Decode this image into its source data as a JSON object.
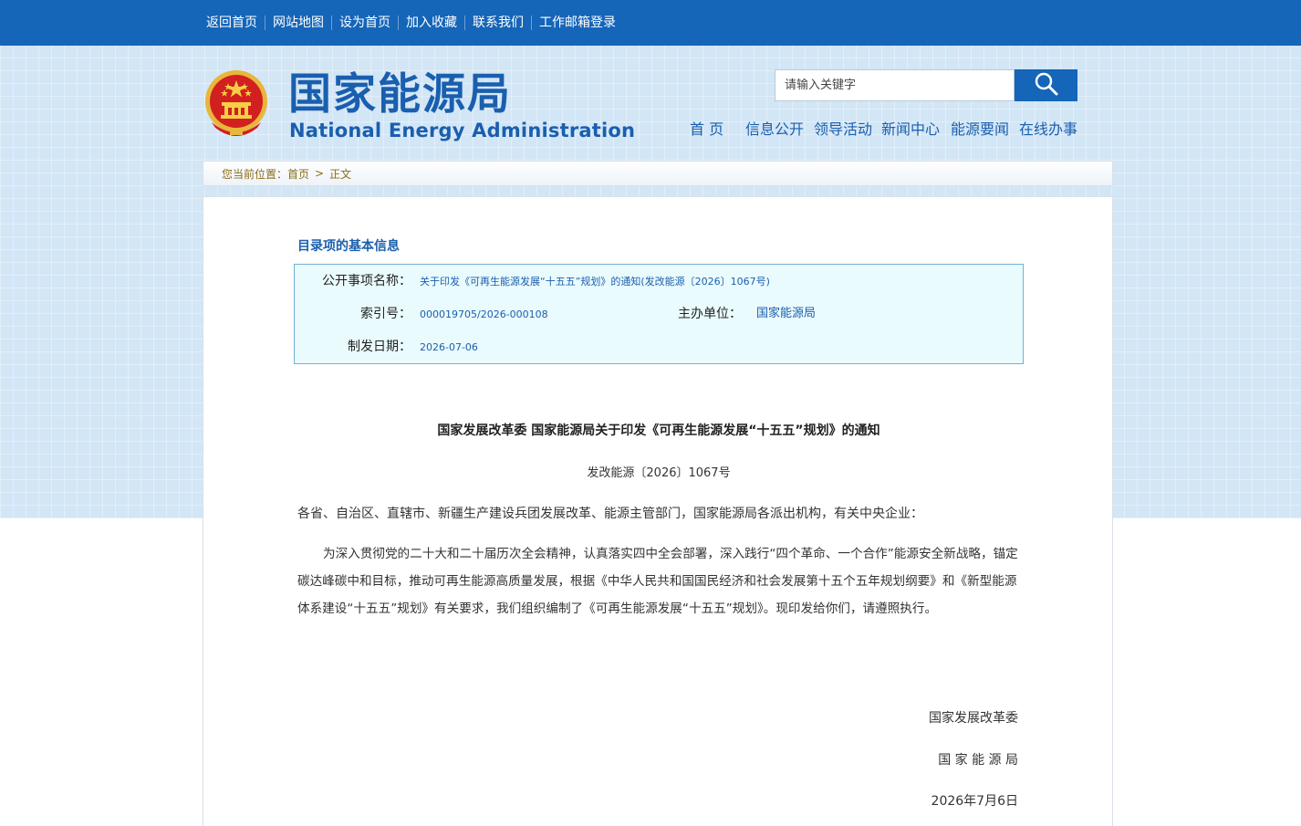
{
  "topbar": {
    "links": [
      "返回首页",
      "网站地图",
      "设为首页",
      "加入收藏",
      "联系我们",
      "工作邮箱登录"
    ]
  },
  "brand": {
    "title_cn": "国家能源局",
    "title_en": "National Energy Administration"
  },
  "search": {
    "placeholder": "请输入关键字"
  },
  "nav": {
    "items": [
      "首 页",
      "信息公开",
      "领导活动",
      "新闻中心",
      "能源要闻",
      "在线办事"
    ]
  },
  "breadcrumb": {
    "prefix": "您当前位置：",
    "home": "首页",
    "separator": ">",
    "current": "正文"
  },
  "info": {
    "heading": "目录项的基本信息",
    "name_label": "公开事项名称：",
    "name_value": "关于印发《可再生能源发展“十五五”规划》的通知(发改能源〔2026〕1067号)",
    "index_label": "索引号：",
    "index_value": "000019705/2026-000108",
    "org_label": "主办单位：",
    "org_value": "国家能源局",
    "date_label": "制发日期：",
    "date_value": "2026-07-06"
  },
  "document": {
    "title": "国家发展改革委 国家能源局关于印发《可再生能源发展“十五五”规划》的通知",
    "number": "发改能源〔2026〕1067号",
    "addressee": "各省、自治区、直辖市、新疆生产建设兵团发展改革、能源主管部门，国家能源局各派出机构，有关中央企业：",
    "body": "为深入贯彻党的二十大和二十届历次全会精神，认真落实四中全会部署，深入践行“四个革命、一个合作”能源安全新战略，锚定碳达峰碳中和目标，推动可再生能源高质量发展，根据《中华人民共和国国民经济和社会发展第十五个五年规划纲要》和《新型能源体系建设“十五五”规划》有关要求，我们组织编制了《可再生能源发展“十五五”规划》。现印发给你们，请遵照执行。",
    "signer1": "国家发展改革委",
    "signer2": "国 家 能 源 局",
    "date": "2026年7月6日"
  },
  "colors": {
    "primary_blue": "#1565b8",
    "title_blue": "#1a5fae",
    "breadcrumb_text": "#8a6d1a",
    "info_box_bg": "#eafbfd",
    "info_box_border": "#6fb2d6"
  }
}
